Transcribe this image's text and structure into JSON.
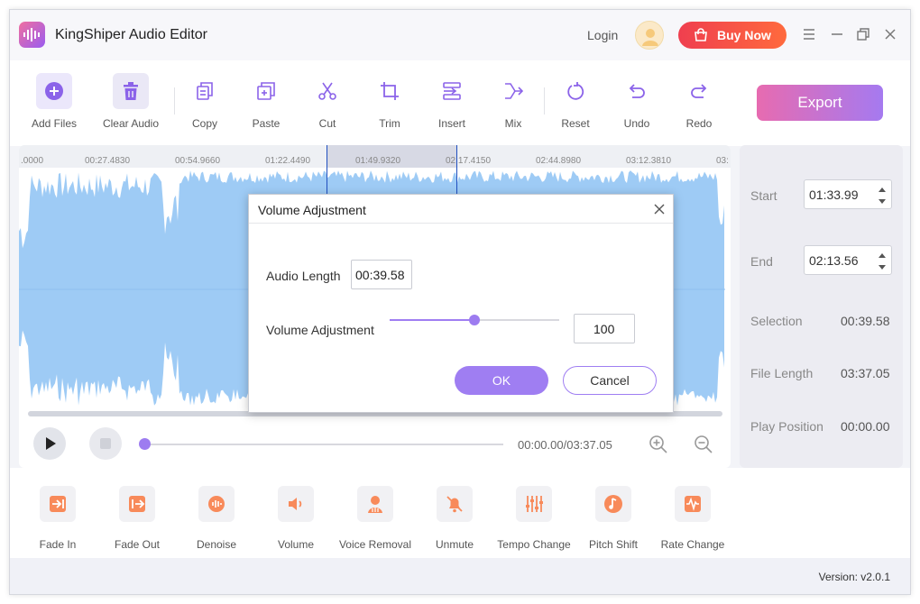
{
  "app": {
    "title": "KingShiper Audio Editor",
    "version": "Version: v2.0.1"
  },
  "header": {
    "login": "Login",
    "buy": "Buy Now"
  },
  "toolbar": {
    "add_files": "Add Files",
    "clear_audio": "Clear Audio",
    "copy": "Copy",
    "paste": "Paste",
    "cut": "Cut",
    "trim": "Trim",
    "insert": "Insert",
    "mix": "Mix",
    "reset": "Reset",
    "undo": "Undo",
    "redo": "Redo",
    "export": "Export"
  },
  "ruler": {
    "ticks": [
      ".0000",
      "00:27.4830",
      "00:54.9660",
      "01:22.4490",
      "01:49.9320",
      "02:17.4150",
      "02:44.8980",
      "03:12.3810",
      "03:"
    ]
  },
  "player": {
    "time": "00:00.00/03:37.05"
  },
  "side": {
    "start_label": "Start",
    "start_value": "01:33.99",
    "end_label": "End",
    "end_value": "02:13.56",
    "selection_label": "Selection",
    "selection_value": "00:39.58",
    "file_length_label": "File Length",
    "file_length_value": "03:37.05",
    "play_position_label": "Play Position",
    "play_position_value": "00:00.00"
  },
  "effects": {
    "fade_in": "Fade In",
    "fade_out": "Fade Out",
    "denoise": "Denoise",
    "volume": "Volume",
    "voice_removal": "Voice Removal",
    "unmute": "Unmute",
    "tempo_change": "Tempo Change",
    "pitch_shift": "Pitch Shift",
    "rate_change": "Rate Change"
  },
  "dialog": {
    "title": "Volume Adjustment",
    "audio_length_label": "Audio Length",
    "audio_length_value": "00:39.58",
    "volume_label": "Volume Adjustment",
    "volume_value": "100",
    "volume_slider_fraction": 0.5,
    "ok": "OK",
    "cancel": "Cancel"
  },
  "colors": {
    "accent": "#9f7ef2",
    "wave": "#9ecbf5",
    "buy_gradient_start": "#ef3f4f",
    "selection_line": "#1f4fbf"
  }
}
